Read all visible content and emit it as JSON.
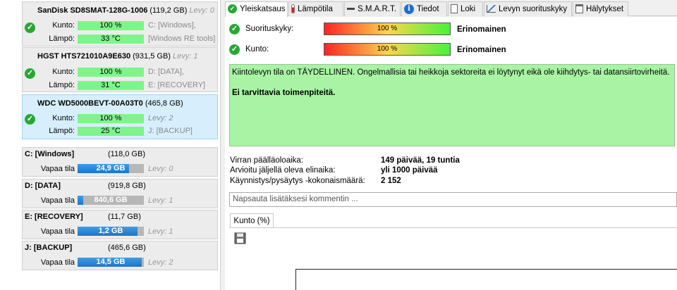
{
  "disks": [
    {
      "name": "SanDisk SD8SMAT-128G-1006",
      "capacity": "(119,2 GB)",
      "levy": "Levy: 0",
      "kunto_label": "Kunto:",
      "kunto_value": "100 %",
      "kunto_side": "C: [Windows],",
      "lampo_label": "Lämpö:",
      "lampo_value": "33 °C",
      "lampo_side": "[Windows RE tools]"
    },
    {
      "name": "HGST HTS721010A9E630",
      "capacity": "(931,5 GB)",
      "levy": "Levy: 1",
      "kunto_label": "Kunto:",
      "kunto_value": "100 %",
      "kunto_side": "D: [DATA],",
      "lampo_label": "Lämpö:",
      "lampo_value": "31 °C",
      "lampo_side": "E: [RECOVERY]"
    },
    {
      "name": "WDC WD5000BEVT-00A03T0",
      "capacity": "(465,8 GB)",
      "levy": "",
      "kunto_label": "Kunto:",
      "kunto_value": "100 %",
      "kunto_side": "Levy: 2",
      "lampo_label": "Lämpö:",
      "lampo_value": "25 °C",
      "lampo_side": "J: [BACKUP]"
    }
  ],
  "volumes": [
    {
      "name": "C: [Windows]",
      "capacity": "(118,0 GB)",
      "free_label": "Vapaa tila",
      "free_value": "24,9 GB",
      "free_fraction": 0.78,
      "levy": "Levy: 0"
    },
    {
      "name": "D: [DATA]",
      "capacity": "(919,8 GB)",
      "free_label": "Vapaa tila",
      "free_value": "840,6 GB",
      "free_fraction": 0.09,
      "levy": "Levy: 1"
    },
    {
      "name": "E: [RECOVERY]",
      "capacity": "(11,7 GB)",
      "free_label": "Vapaa tila",
      "free_value": "1,2 GB",
      "free_fraction": 0.9,
      "levy": "Levy: 1"
    },
    {
      "name": "J: [BACKUP]",
      "capacity": "(465,6 GB)",
      "free_label": "Vapaa tila",
      "free_value": "14,5 GB",
      "free_fraction": 0.97,
      "levy": "Levy: 2"
    }
  ],
  "tabs": [
    {
      "label": "Yleiskatsaus",
      "icon": "check-icon"
    },
    {
      "label": "Lämpötila",
      "icon": "thermometer-icon"
    },
    {
      "label": "S.M.A.R.T.",
      "icon": "minus-icon"
    },
    {
      "label": "Tiedot",
      "icon": "info-icon"
    },
    {
      "label": "Loki",
      "icon": "document-icon"
    },
    {
      "label": "Levyn suorituskyky",
      "icon": "chart-icon"
    },
    {
      "label": "Hälytykset",
      "icon": "clipboard-icon"
    }
  ],
  "status": {
    "performance_label": "Suorituskyky:",
    "performance_value": "100 %",
    "performance_result": "Erinomainen",
    "health_label": "Kunto:",
    "health_value": "100 %",
    "health_result": "Erinomainen"
  },
  "summary": {
    "message": "Kiintolevyn tila on TÄYDELLINEN. Ongelmallisia tai heikkoja sektoreita ei löytynyt eikä ole kiihdytys- tai datansiirtovirheitä.",
    "action": "Ei tarvittavia toimenpiteitä."
  },
  "info": [
    {
      "label": "Virran päälläoloaika:",
      "value": "149 päivää, 19 tuntia"
    },
    {
      "label": "Arvioitu jäljellä oleva elinaika:",
      "value": "yli 1000 päivää"
    },
    {
      "label": "Käynnistys/pysäytys -kokonaismäärä:",
      "value": "2 152"
    }
  ],
  "comment_placeholder": "Napsauta lisätäksesi kommentin ...",
  "chart_tab_label": "Kunto (%)",
  "colors": {
    "ok": "#27a833",
    "summary_bg": "#a8f4a4",
    "selected_disk": "#d7effd",
    "volume_bar": "#1d76c6"
  }
}
